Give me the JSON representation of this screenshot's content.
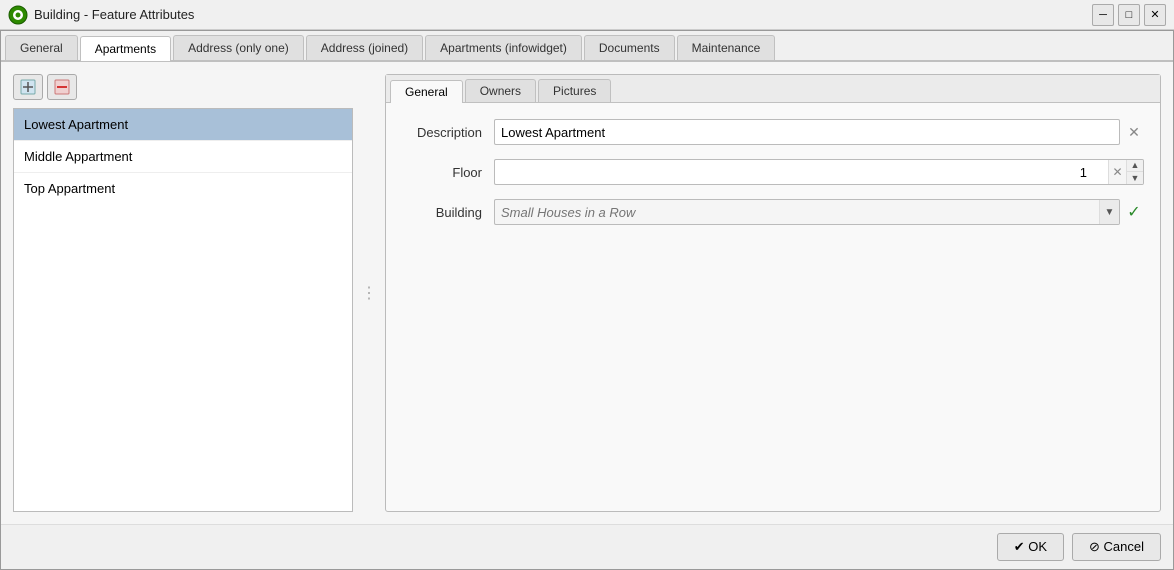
{
  "titlebar": {
    "title": "Building - Feature Attributes",
    "logo": "Q",
    "controls": {
      "minimize": "─",
      "maximize": "□",
      "close": "✕"
    }
  },
  "tabs": [
    {
      "label": "General",
      "active": false
    },
    {
      "label": "Apartments",
      "active": true
    },
    {
      "label": "Address (only one)",
      "active": false
    },
    {
      "label": "Address (joined)",
      "active": false
    },
    {
      "label": "Apartments (infowidget)",
      "active": false
    },
    {
      "label": "Documents",
      "active": false
    },
    {
      "label": "Maintenance",
      "active": false
    }
  ],
  "toolbar": {
    "add_title": "Add",
    "delete_title": "Delete"
  },
  "list": {
    "items": [
      {
        "label": "Lowest Apartment",
        "selected": true
      },
      {
        "label": "Middle Appartment",
        "selected": false
      },
      {
        "label": "Top Appartment",
        "selected": false
      }
    ]
  },
  "inner_tabs": [
    {
      "label": "General",
      "active": true
    },
    {
      "label": "Owners",
      "active": false
    },
    {
      "label": "Pictures",
      "active": false
    }
  ],
  "form": {
    "description_label": "Description",
    "description_value": "Lowest Apartment",
    "floor_label": "Floor",
    "floor_value": "1",
    "building_label": "Building",
    "building_placeholder": "Small Houses in a Row"
  },
  "footer": {
    "ok_label": "✔ OK",
    "cancel_label": "⊘ Cancel"
  }
}
